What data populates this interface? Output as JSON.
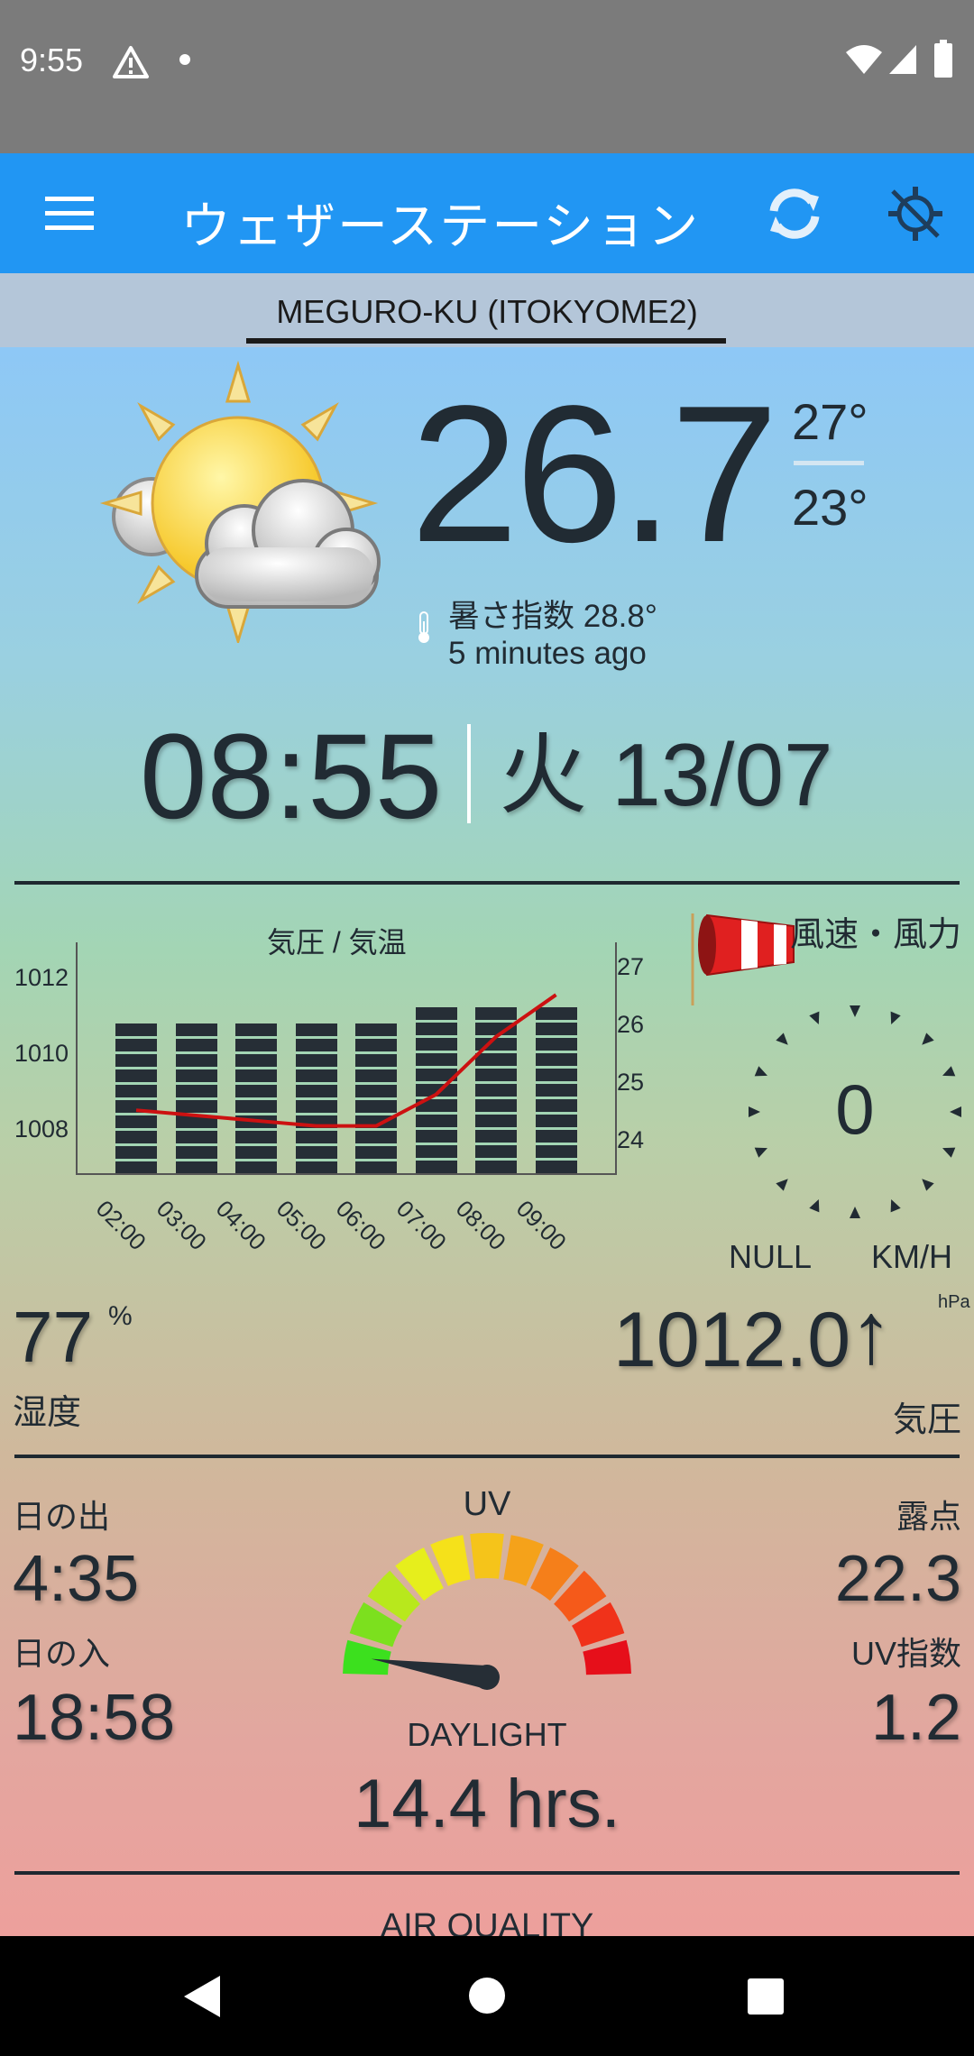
{
  "status_bar": {
    "time": "9:55"
  },
  "app_bar": {
    "title": "ウェザーステーション"
  },
  "station": {
    "name": "MEGURO-KU (ITOKYOME2)"
  },
  "current": {
    "temperature": "26.7",
    "high": "27°",
    "low": "23°",
    "heat_index": "暑さ指数 28.8°",
    "updated": "5 minutes ago"
  },
  "clock": {
    "time": "08:55",
    "date": "火 13/07"
  },
  "pressure_chart_title": "気圧 / 気温",
  "chart_data": {
    "type": "bar",
    "title": "気圧 / 気温",
    "categories": [
      "02:00",
      "03:00",
      "04:00",
      "05:00",
      "06:00",
      "07:00",
      "08:00",
      "09:00"
    ],
    "left_ticks": [
      "1012",
      "1010",
      "1008"
    ],
    "right_ticks": [
      "27",
      "26",
      "25",
      "24"
    ],
    "ylim_left": [
      1006.4,
      1013.5
    ],
    "ylim_right": [
      23.0,
      27.4
    ],
    "series": [
      {
        "type": "bar",
        "axis": "left",
        "values": [
          1011.0,
          1011.0,
          1011.0,
          1011.0,
          1011.0,
          1011.5,
          1011.5,
          1011.5
        ]
      },
      {
        "type": "line",
        "axis": "right",
        "color": "#cc1111",
        "values": [
          24.2,
          24.1,
          24.0,
          23.9,
          23.9,
          24.5,
          25.6,
          26.4
        ]
      }
    ]
  },
  "wind": {
    "title": "風速・風力",
    "speed": "0",
    "direction": "NULL",
    "unit": "KM/H"
  },
  "humidity": {
    "value": "77",
    "unit": "%",
    "label": "湿度"
  },
  "pressure": {
    "value": "1012.0",
    "arrow": "↑",
    "unit": "hPa",
    "label": "気圧"
  },
  "sun": {
    "sunrise_label": "日の出",
    "sunrise": "4:35",
    "sunset_label": "日の入",
    "sunset": "18:58",
    "daylight_label": "DAYLIGHT",
    "daylight": "14.4 hrs."
  },
  "uv": {
    "label": "UV",
    "level": 0.05,
    "index_label": "UV指数",
    "index": "1.2"
  },
  "dew_point": {
    "label": "露点",
    "value": "22.3"
  },
  "air_quality": {
    "label": "AIR QUALITY"
  }
}
